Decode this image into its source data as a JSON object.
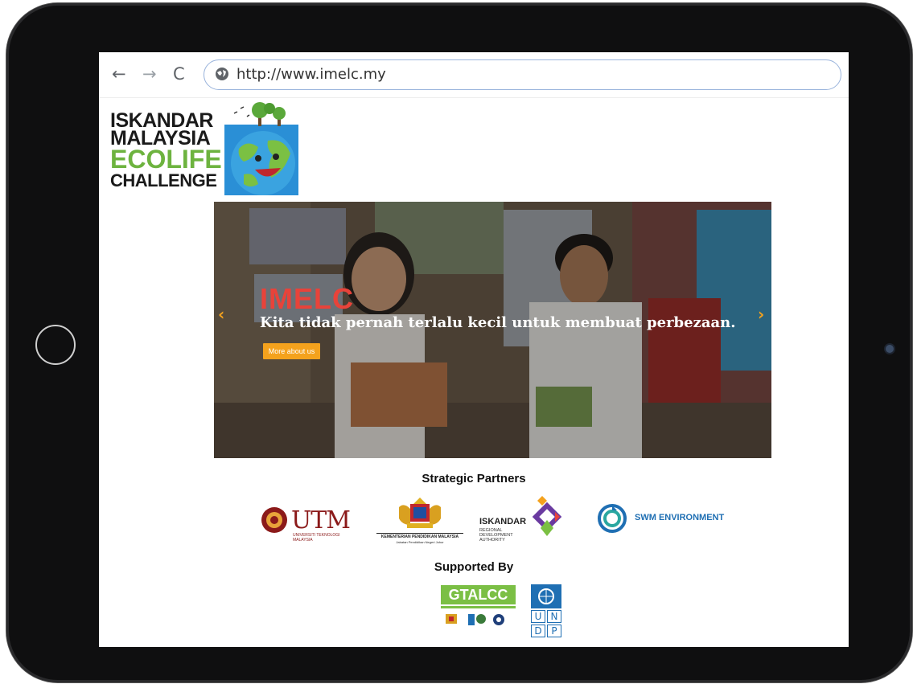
{
  "browser": {
    "back_glyph": "←",
    "forward_glyph": "→",
    "reload_glyph": "C",
    "url": "http://www.imelc.my",
    "icons": [
      "back-arrow-icon",
      "forward-arrow-icon",
      "reload-icon",
      "globe-icon"
    ]
  },
  "logo": {
    "line1": "ISKANDAR",
    "line2": "MALAYSIA",
    "line3": "ECOLIFE",
    "line4": "CHALLENGE"
  },
  "hero": {
    "title": "IMELC",
    "subtitle": "Kita tidak pernah terlalu kecil untuk membuat perbezaan.",
    "button_label": "More about us",
    "prev_glyph": "‹",
    "next_glyph": "›"
  },
  "partners": {
    "heading": "Strategic Partners",
    "utm": {
      "name": "UTM",
      "sub": "UNIVERSITI TEKNOLOGI MALAYSIA"
    },
    "kpm": {
      "name": "KEMENTERIAN PENDIDIKAN MALAYSIA",
      "sub": "Jabatan Pendidikan Negeri Johor"
    },
    "irda": {
      "name": "ISKANDAR",
      "sub": "REGIONAL DEVELOPMENT AUTHORITY"
    },
    "swm": {
      "name": "SWM ENVIRONMENT"
    }
  },
  "supporters": {
    "heading": "Supported By",
    "gtalcc": "GTALCC",
    "undp": [
      "U",
      "N",
      "D",
      "P"
    ]
  },
  "colors": {
    "accent_orange": "#f4a21d",
    "hero_title_red": "#e8433a",
    "eco_green": "#6db33f",
    "undp_blue": "#1f6fb3"
  }
}
